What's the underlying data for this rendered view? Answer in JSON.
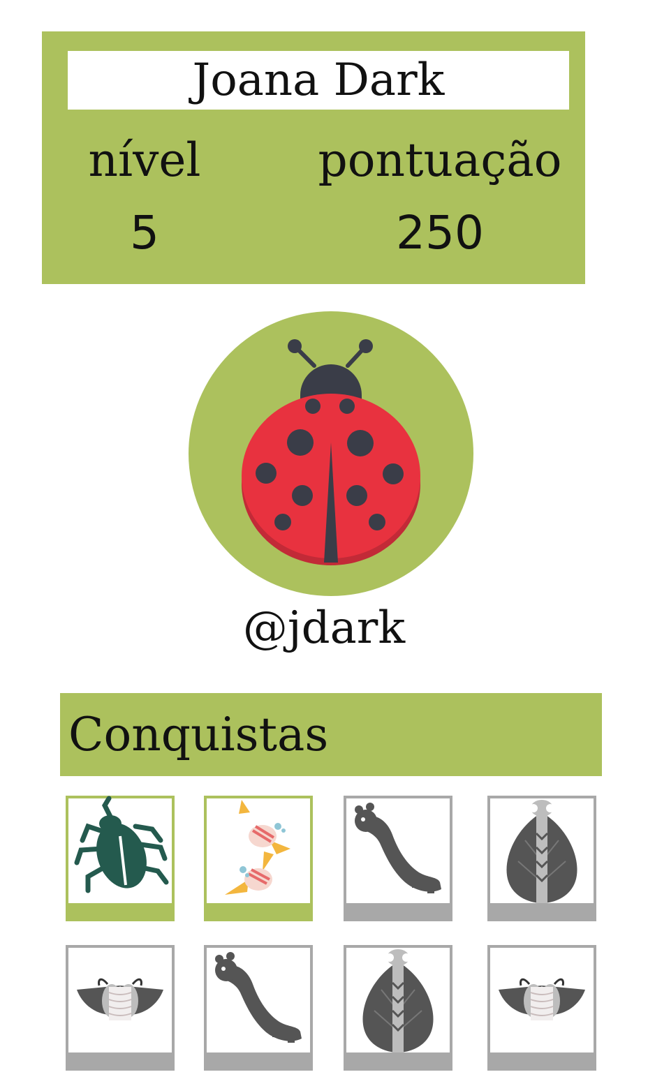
{
  "profile": {
    "name": "Joana Dark",
    "level_label": "nível",
    "level_value": "5",
    "score_label": "pontuação",
    "score_value": "250",
    "username": "@jdark",
    "avatar_icon": "ladybug-icon"
  },
  "achievements": {
    "title": "Conquistas",
    "badges": [
      {
        "icon": "beetle-icon",
        "unlocked": true
      },
      {
        "icon": "bees-icon",
        "unlocked": true
      },
      {
        "icon": "caterpillar-icon",
        "unlocked": false
      },
      {
        "icon": "cicada-icon",
        "unlocked": false
      },
      {
        "icon": "moths-icon",
        "unlocked": false
      },
      {
        "icon": "caterpillar-icon",
        "unlocked": false
      },
      {
        "icon": "cicada-icon",
        "unlocked": false
      },
      {
        "icon": "moths-icon",
        "unlocked": false
      }
    ]
  },
  "colors": {
    "accent": "#acc15d",
    "locked": "#a8a8a8",
    "ladybug_red": "#e8323f",
    "ladybug_dark": "#3a3d48"
  }
}
